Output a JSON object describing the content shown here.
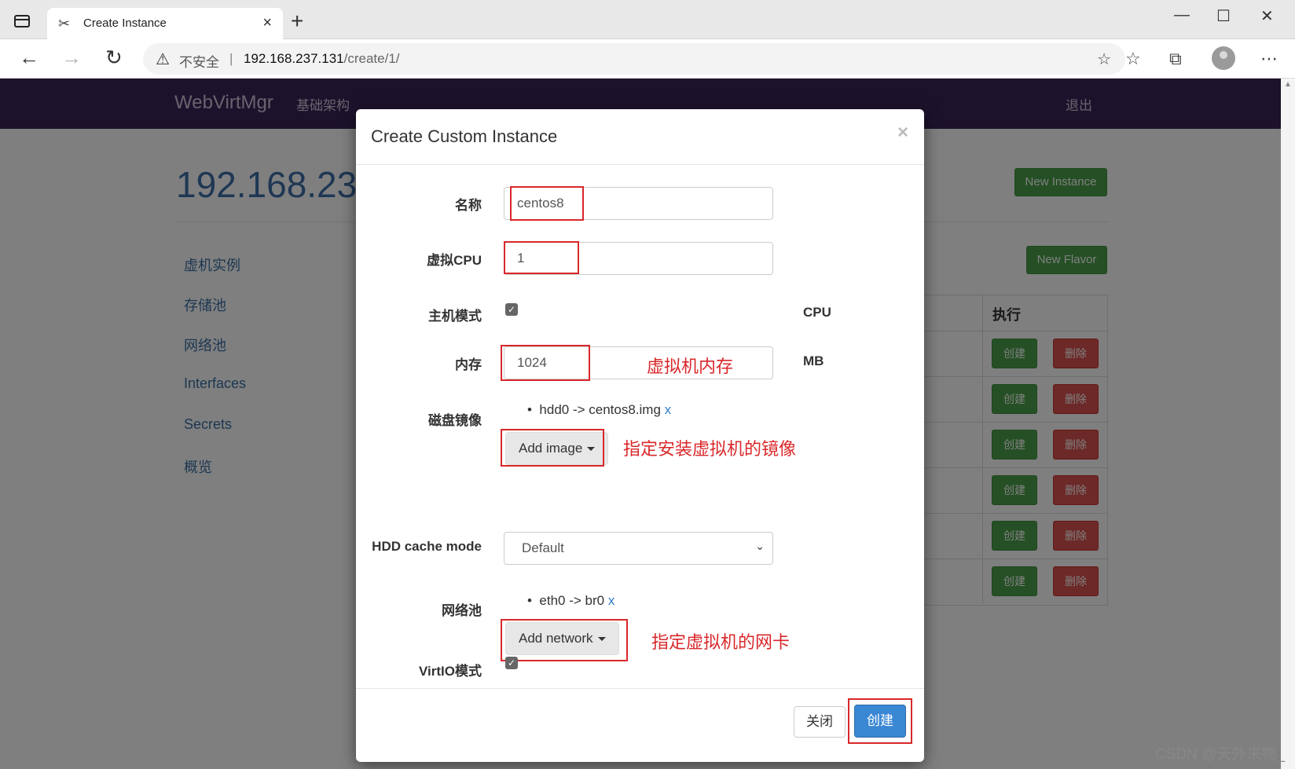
{
  "browser": {
    "tab_title": "Create Instance",
    "tab_close": "×",
    "new_tab": "+",
    "window_minimize": "—",
    "window_maximize": "☐",
    "window_close": "✕",
    "back": "←",
    "forward": "→",
    "reload": "↻",
    "insecure_label": "不安全",
    "separator": "|",
    "url_host": "192.168.237.131",
    "url_path": "/create/1/"
  },
  "navbar": {
    "brand": "WebVirtMgr",
    "infrastructure": "基础架构",
    "logout": "退出"
  },
  "page": {
    "host_title": "192.168.23",
    "new_instance": "New Instance",
    "new_flavor": "New Flavor"
  },
  "sidebar": {
    "items": [
      {
        "label": "虚机实例"
      },
      {
        "label": "存储池"
      },
      {
        "label": "网络池"
      },
      {
        "label": "Interfaces"
      },
      {
        "label": "Secrets"
      },
      {
        "label": "概览"
      }
    ]
  },
  "table": {
    "action_header": "执行",
    "create_label": "创建",
    "delete_label": "删除"
  },
  "modal": {
    "title": "Create Custom Instance",
    "close_x": "×",
    "name_label": "名称",
    "name_value": "centos8",
    "vcpu_label": "虚拟CPU",
    "vcpu_value": "1",
    "host_mode_label": "主机模式",
    "cpu_unit": "CPU",
    "memory_label": "内存",
    "memory_value": "1024",
    "memory_unit": "MB",
    "disk_label": "磁盘镜像",
    "disk_item": "hdd0 -> centos8.img",
    "disk_remove": "x",
    "add_image": "Add image",
    "cache_label": "HDD cache mode",
    "cache_value": "Default",
    "network_label": "网络池",
    "network_item": "eth0 -> br0",
    "network_remove": "x",
    "add_network": "Add network",
    "virtio_label": "VirtIO模式",
    "close_button": "关闭",
    "create_button": "创建"
  },
  "annotations": {
    "memory": "虚拟机内存",
    "image": "指定安装虚拟机的镜像",
    "network": "指定虚拟机的网卡"
  },
  "watermark": "CSDN @天外来物_",
  "colors": {
    "navbar": "#3a2558",
    "annotation_red": "#d9282b",
    "primary_blue": "#3a87d4",
    "success_green": "#4aa04a",
    "danger_red": "#d9534f"
  }
}
